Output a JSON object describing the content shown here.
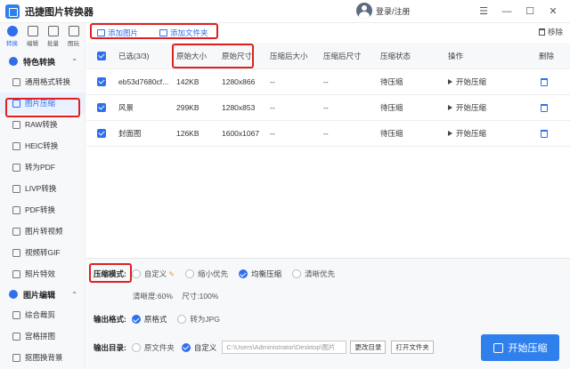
{
  "app": {
    "title": "迅捷图片转换器",
    "login": "登录/注册"
  },
  "window": {
    "menu": "☰",
    "min": "—",
    "max": "☐",
    "close": "✕"
  },
  "topnav": [
    {
      "label": "转换",
      "active": true
    },
    {
      "label": "编辑"
    },
    {
      "label": "批量"
    },
    {
      "label": "图玩"
    }
  ],
  "sidebar": {
    "section1": "特色转换",
    "items": [
      {
        "label": "通用格式转换"
      },
      {
        "label": "图片压缩",
        "active": true
      },
      {
        "label": "RAW转换"
      },
      {
        "label": "HEIC转换"
      },
      {
        "label": "转为PDF"
      },
      {
        "label": "LIVP转换"
      },
      {
        "label": "PDF转换"
      },
      {
        "label": "图片转视频"
      },
      {
        "label": "视频转GIF"
      },
      {
        "label": "照片特效"
      }
    ],
    "section2": "图片编辑",
    "items2": [
      {
        "label": "综合裁剪"
      },
      {
        "label": "宫格拼图"
      },
      {
        "label": "抠图换背景"
      }
    ]
  },
  "toolbar": {
    "add_image": "添加图片",
    "add_folder": "添加文件夹",
    "remove": "移除"
  },
  "table": {
    "headers": {
      "selected": "已选(3/3)",
      "orig_size": "原始大小",
      "orig_dim": "原始尺寸",
      "comp_size": "压缩后大小",
      "comp_dim": "压缩后尺寸",
      "status": "压缩状态",
      "action": "操作",
      "delete": "删除"
    },
    "rows": [
      {
        "name": "eb53d7680cf...",
        "size": "142KB",
        "dim": "1280x866",
        "csize": "--",
        "cdim": "--",
        "status": "待压缩",
        "action": "开始压缩"
      },
      {
        "name": "风景",
        "size": "299KB",
        "dim": "1280x853",
        "csize": "--",
        "cdim": "--",
        "status": "待压缩",
        "action": "开始压缩"
      },
      {
        "name": "封面图",
        "size": "126KB",
        "dim": "1600x1067",
        "csize": "--",
        "cdim": "--",
        "status": "待压缩",
        "action": "开始压缩"
      }
    ]
  },
  "settings": {
    "mode_label": "压缩模式:",
    "modes": [
      {
        "label": "自定义",
        "selected": false
      },
      {
        "label": "缩小优先",
        "selected": false
      },
      {
        "label": "均衡压缩",
        "selected": true
      },
      {
        "label": "清晰优先",
        "selected": false
      }
    ],
    "clarity": "清晰度:60%",
    "size_ratio": "尺寸:100%",
    "format_label": "输出格式:",
    "formats": [
      {
        "label": "原格式",
        "selected": true
      },
      {
        "label": "转为JPG",
        "selected": false
      }
    ],
    "dir_label": "输出目录:",
    "dirs": [
      {
        "label": "原文件夹",
        "selected": false
      },
      {
        "label": "自定义",
        "selected": true
      }
    ],
    "path": "C:\\Users\\Administrator\\Desktop\\图片",
    "change_dir": "更改目录",
    "open_folder": "打开文件夹",
    "start": "开始压缩"
  },
  "colors": {
    "accent": "#2f80ed",
    "highlight": "#e02020"
  }
}
